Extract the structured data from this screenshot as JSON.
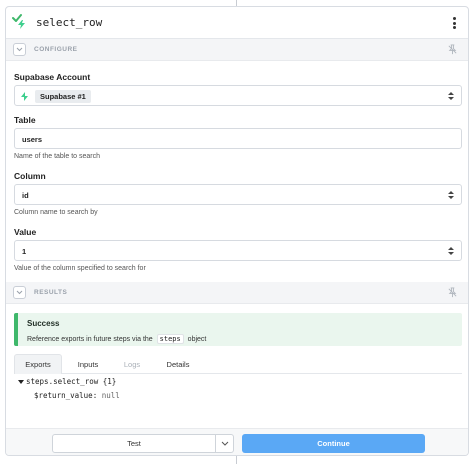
{
  "header": {
    "title": "select_row",
    "app_icon": "zap-check-icon",
    "menu_icon": "kebab-menu-icon"
  },
  "configure": {
    "label": "CONFIGURE"
  },
  "fields": {
    "account": {
      "label": "Supabase Account",
      "value": "Supabase #1"
    },
    "table": {
      "label": "Table",
      "value": "users",
      "help": "Name of the table to search"
    },
    "column": {
      "label": "Column",
      "value": "id",
      "help": "Column name to search by"
    },
    "value": {
      "label": "Value",
      "value": "1",
      "help": "Value of the column specified to search for"
    }
  },
  "results": {
    "label": "RESULTS"
  },
  "success": {
    "title": "Success",
    "text_before": "Reference exports in future steps via the",
    "code": "steps",
    "text_after": "object"
  },
  "tabs": [
    "Exports",
    "Inputs",
    "Logs",
    "Details"
  ],
  "active_tab": "Exports",
  "disabled_tab": "Logs",
  "exports": {
    "root": "steps.select_row {1}",
    "key": "$return_value:",
    "value": "null"
  },
  "footer": {
    "test_label": "Test",
    "continue_label": "Continue"
  },
  "colors": {
    "accent": "#5aa8f5",
    "success": "#3fb86b",
    "supabase": "#3ecf8e"
  }
}
